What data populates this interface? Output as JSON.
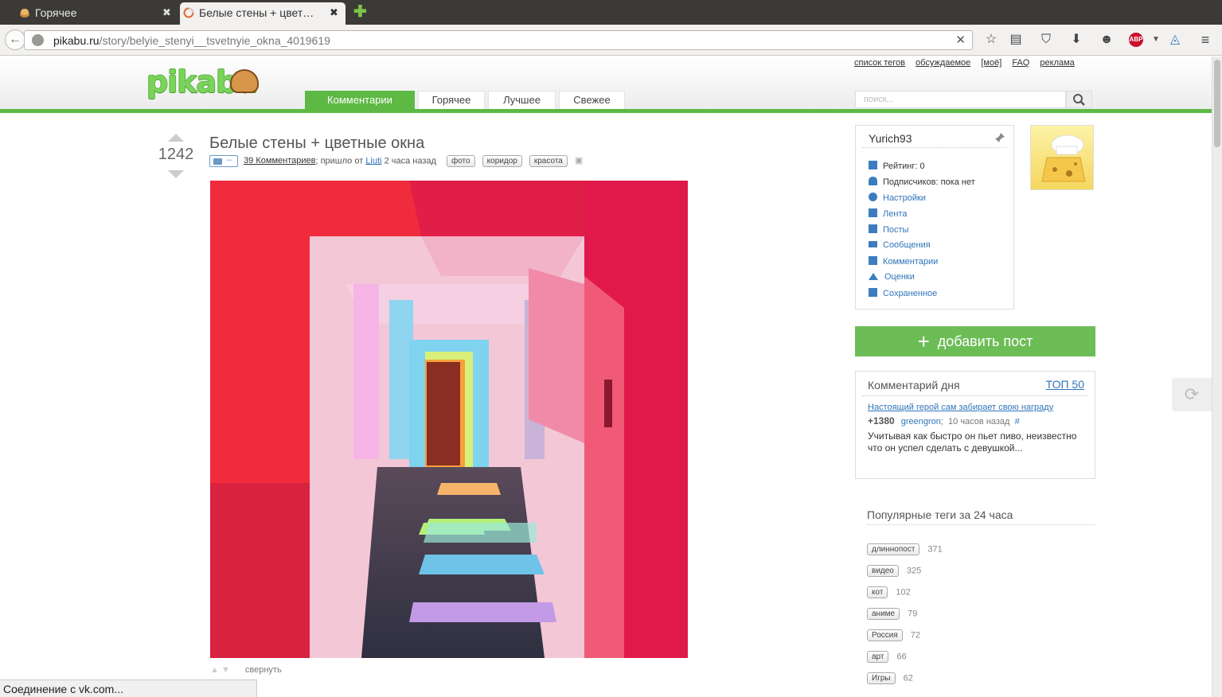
{
  "browser": {
    "tabs": [
      {
        "label": "Горячее",
        "active": false
      },
      {
        "label": "Белые стены + цвет…",
        "active": true
      }
    ],
    "url_host": "pikabu.ru",
    "url_path": "/story/belyie_stenyi__tsvetnyie_okna_4019619",
    "status_text": "Соединение с vk.com..."
  },
  "header": {
    "logo_text": "pikabu",
    "top_links": [
      "список тегов",
      "обсуждаемое",
      "[моё]",
      "FAQ",
      "реклама"
    ],
    "nav_tabs": [
      {
        "label": "Комментарии",
        "active": true
      },
      {
        "label": "Горячее",
        "active": false
      },
      {
        "label": "Лучшее",
        "active": false
      },
      {
        "label": "Свежее",
        "active": false
      }
    ],
    "search_placeholder": "поиск..."
  },
  "post": {
    "rating": "1242",
    "title": "Белые стены + цветные окна",
    "photo_badge": "–",
    "comments_link": "39 Комментариев",
    "from_text": "; пришло от",
    "author": "Liuti",
    "time": "2 часа назад",
    "tags": [
      "фото",
      "коридор",
      "красота"
    ],
    "collapse_label": "свернуть"
  },
  "user": {
    "name": "Yurich93",
    "rating": "Рейтинг: 0",
    "subscribers": "Подписчиков: пока нет",
    "links": [
      "Настройки",
      "Лента",
      "Посты",
      "Сообщения",
      "Комментарии",
      "Оценки",
      "Сохраненное"
    ]
  },
  "add_post_label": "добавить пост",
  "comment_of_day": {
    "title": "Комментарий дня",
    "top_link": "ТОП 50",
    "post_link": "Настоящий герой сам забирает свою награду",
    "score": "+1380",
    "author": "greengron",
    "time": "10 часов назад",
    "hash": "#",
    "text": "Учитывая как быстро он пьет пиво, неизвестно что он успел сделать с девушкой..."
  },
  "popular_tags": {
    "title": "Популярные теги за 24 часа",
    "items": [
      {
        "tag": "длиннопост",
        "count": "371"
      },
      {
        "tag": "видео",
        "count": "325"
      },
      {
        "tag": "кот",
        "count": "102"
      },
      {
        "tag": "аниме",
        "count": "79"
      },
      {
        "tag": "Россия",
        "count": "72"
      },
      {
        "tag": "арт",
        "count": "66"
      },
      {
        "tag": "Игры",
        "count": "62"
      }
    ]
  },
  "colors": {
    "brand_green": "#5db844",
    "link_blue": "#2f74b9"
  }
}
